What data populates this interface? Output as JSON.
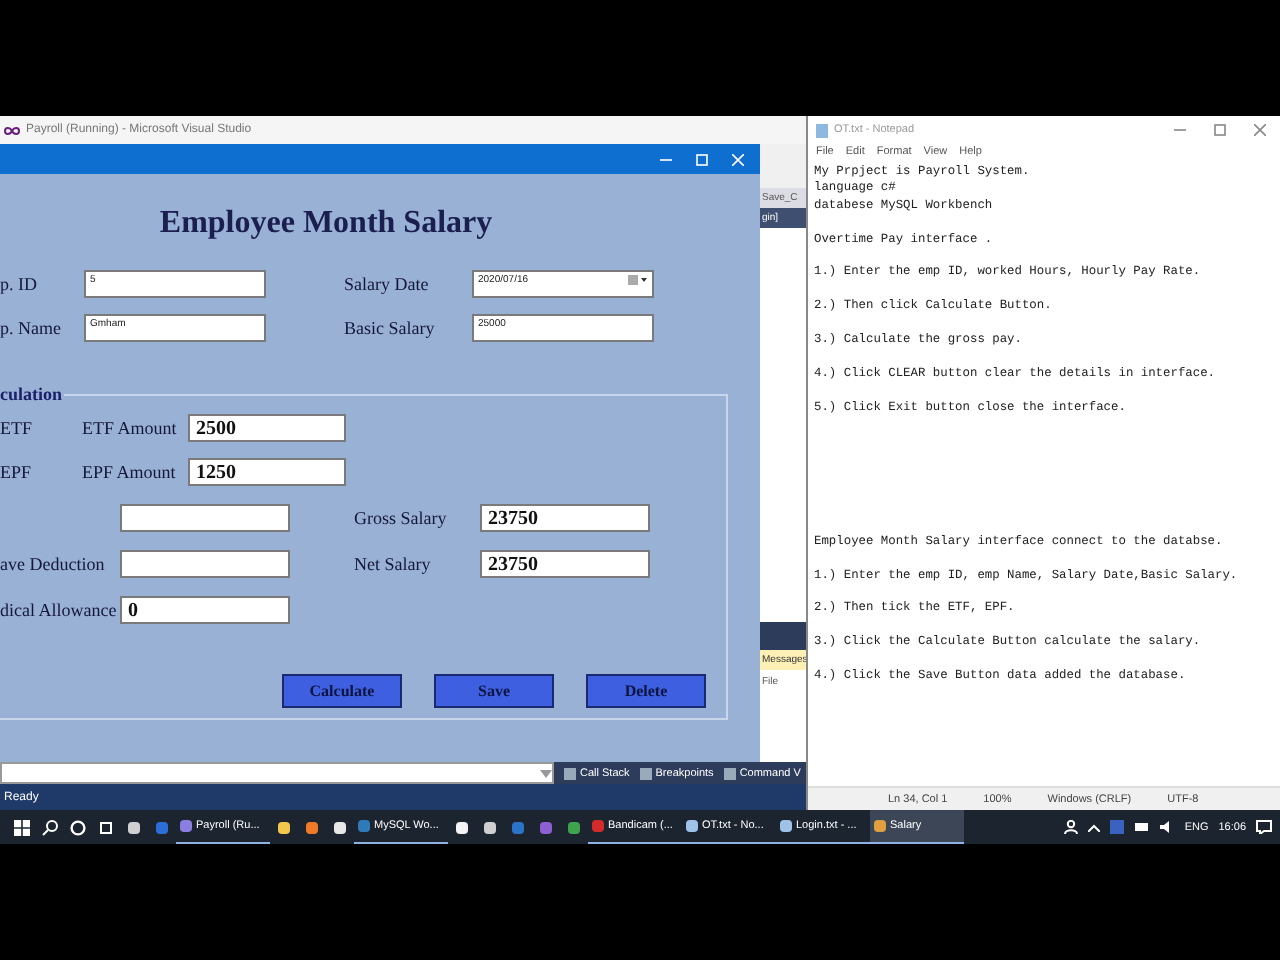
{
  "visual_studio": {
    "title": "Payroll (Running) - Microsoft Visual Studio",
    "side_texts": [
      "Save_C",
      "gin]"
    ],
    "output_tab": "Messages",
    "output_column": "File",
    "bottom_tabs": [
      "Call Stack",
      "Breakpoints",
      "Command V"
    ],
    "status": "Ready"
  },
  "salary_form": {
    "heading": "Employee Month Salary",
    "top_fields": [
      {
        "label": "p. ID",
        "value": "5",
        "kind": "text"
      },
      {
        "label": "Salary Date",
        "value": "2020/07/16",
        "kind": "date"
      },
      {
        "label": "p. Name",
        "value": "Gmham",
        "kind": "text"
      },
      {
        "label": "Basic Salary",
        "value": "25000",
        "kind": "text"
      }
    ],
    "group": {
      "title": "culation",
      "deductions": [
        {
          "check_label": "ETF",
          "label": "ETF Amount",
          "value": "2500"
        },
        {
          "check_label": "EPF",
          "label": "EPF Amount",
          "value": "1250"
        }
      ],
      "left_fields": [
        {
          "kind": "text"
        },
        {
          "label": "ave Deduction",
          "kind": "text"
        },
        {
          "label": "dical Allowance",
          "value": "0",
          "kind": "text"
        }
      ],
      "right_fields": [
        {
          "label": "Gross Salary",
          "value": "23750"
        },
        {
          "label": "Net Salary",
          "value": "23750"
        }
      ],
      "buttons": [
        "Calculate",
        "Save",
        "Delete"
      ]
    }
  },
  "notepad": {
    "title": "OT.txt - Notepad",
    "menu": [
      "File",
      "Edit",
      "Format",
      "View",
      "Help"
    ],
    "sections": [
      [
        [
          "My Prpject is Payroll System.",
          "language c#",
          "databese MySQL Workbench"
        ],
        [
          "Overtime Pay interface ."
        ],
        [
          "1.) Enter the emp ID, worked Hours, Hourly Pay Rate."
        ],
        [
          "2.) Then click Calculate Button."
        ],
        [
          "3.) Calculate the gross pay."
        ],
        [
          "4.) Click CLEAR button clear the details in interface."
        ],
        [
          "5.) Click Exit button close the interface."
        ]
      ],
      [
        [
          "Employee Month Salary interface connect to the databse."
        ],
        [
          "1.) Enter the emp ID, emp Name, Salary Date,Basic Salary."
        ],
        [
          "2.) Then tick the ETF, EPF."
        ],
        [
          "3.) Click the Calculate Button calculate the salary."
        ],
        [
          "4.) Click the Save Button data added the database."
        ]
      ]
    ],
    "status": [
      "Ln 34, Col 1",
      "100%",
      "Windows (CRLF)",
      "UTF-8"
    ]
  },
  "taskbar": {
    "items": [
      {
        "kind": "start"
      },
      {
        "kind": "search"
      },
      {
        "kind": "cortana"
      },
      {
        "kind": "taskview"
      },
      {
        "kind": "app",
        "color": "#d0d0d0"
      },
      {
        "kind": "app",
        "color": "#2b6fd6"
      },
      {
        "kind": "window",
        "label": "Payroll (Ru...",
        "color": "#8a7ee0",
        "selected": false
      },
      {
        "kind": "app",
        "color": "#f2c94c"
      },
      {
        "kind": "app",
        "color": "#f07a2a"
      },
      {
        "kind": "app",
        "color": "#e8e8e8"
      },
      {
        "kind": "window",
        "label": "MySQL Wo...",
        "color": "#2f7ab8",
        "selected": false
      },
      {
        "kind": "app",
        "color": "#f4f4f4"
      },
      {
        "kind": "app",
        "color": "#cfcfcf"
      },
      {
        "kind": "app",
        "color": "#2a73c9"
      },
      {
        "kind": "app",
        "color": "#8d5fd3"
      },
      {
        "kind": "app",
        "color": "#3fa34d"
      },
      {
        "kind": "window",
        "label": "Bandicam (...",
        "color": "#d42a2a",
        "selected": false
      },
      {
        "kind": "window",
        "label": "OT.txt - No...",
        "color": "#9fc3e8",
        "selected": false
      },
      {
        "kind": "window",
        "label": "Login.txt - ...",
        "color": "#9fc3e8",
        "selected": false
      },
      {
        "kind": "window",
        "label": "Salary",
        "color": "#e0a040",
        "selected": true
      }
    ],
    "language": "ENG",
    "time": "16:06"
  }
}
